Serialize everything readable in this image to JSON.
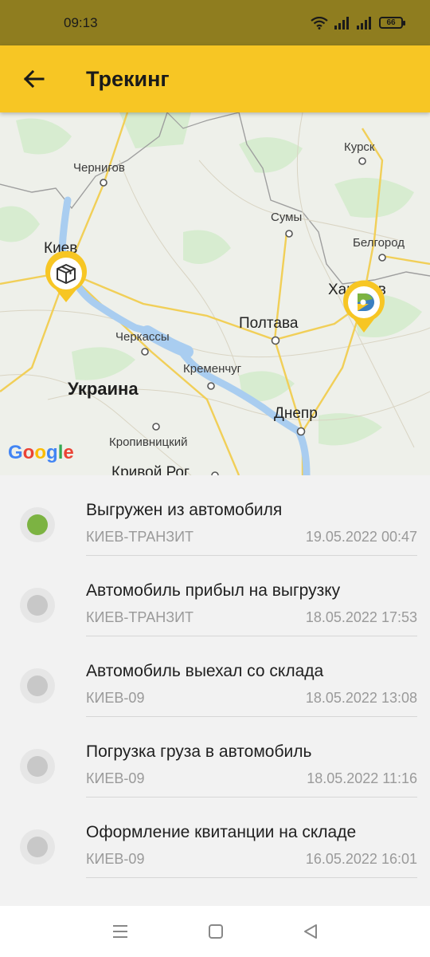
{
  "status_bar": {
    "time": "09:13",
    "battery": "66",
    "icons": [
      "wifi-icon",
      "signal-icon",
      "signal-icon",
      "battery-icon"
    ]
  },
  "app_bar": {
    "title": "Трекинг",
    "back_icon": "arrow-left-icon"
  },
  "map": {
    "labels": {
      "kursk": "Курск",
      "chernigov": "Чернигов",
      "sumy": "Сумы",
      "belgorod": "Белгород",
      "kiev": "Киев",
      "kharkov": "Харьков",
      "poltava": "Полтава",
      "cherkassy": "Черкассы",
      "kremenchug": "Кременчуг",
      "ukraine": "Украина",
      "dnepr": "Днепр",
      "kropivnitsky": "Кропивницкий",
      "krivoy_rog": "Кривой Рог"
    },
    "attribution": "Google",
    "markers": [
      "package-icon",
      "courier-logo-icon"
    ]
  },
  "tracking": [
    {
      "title": "Выгружен из автомобиля",
      "place": "КИЕВ-ТРАНЗИТ",
      "date": "19.05.2022 00:47",
      "active": true
    },
    {
      "title": "Автомобиль прибыл на выгрузку",
      "place": "КИЕВ-ТРАНЗИТ",
      "date": "18.05.2022 17:53",
      "active": false
    },
    {
      "title": "Автомобиль выехал со склада",
      "place": "КИЕВ-09",
      "date": "18.05.2022 13:08",
      "active": false
    },
    {
      "title": "Погрузка груза в автомобиль",
      "place": "КИЕВ-09",
      "date": "18.05.2022 11:16",
      "active": false
    },
    {
      "title": "Оформление квитанции на складе",
      "place": "КИЕВ-09",
      "date": "16.05.2022 16:01",
      "active": false
    }
  ],
  "colors": {
    "app_bar": "#f7c624",
    "status_bar": "#8f7d1f",
    "active_dot": "#7cb342",
    "inactive_dot": "#c8c8c8"
  }
}
